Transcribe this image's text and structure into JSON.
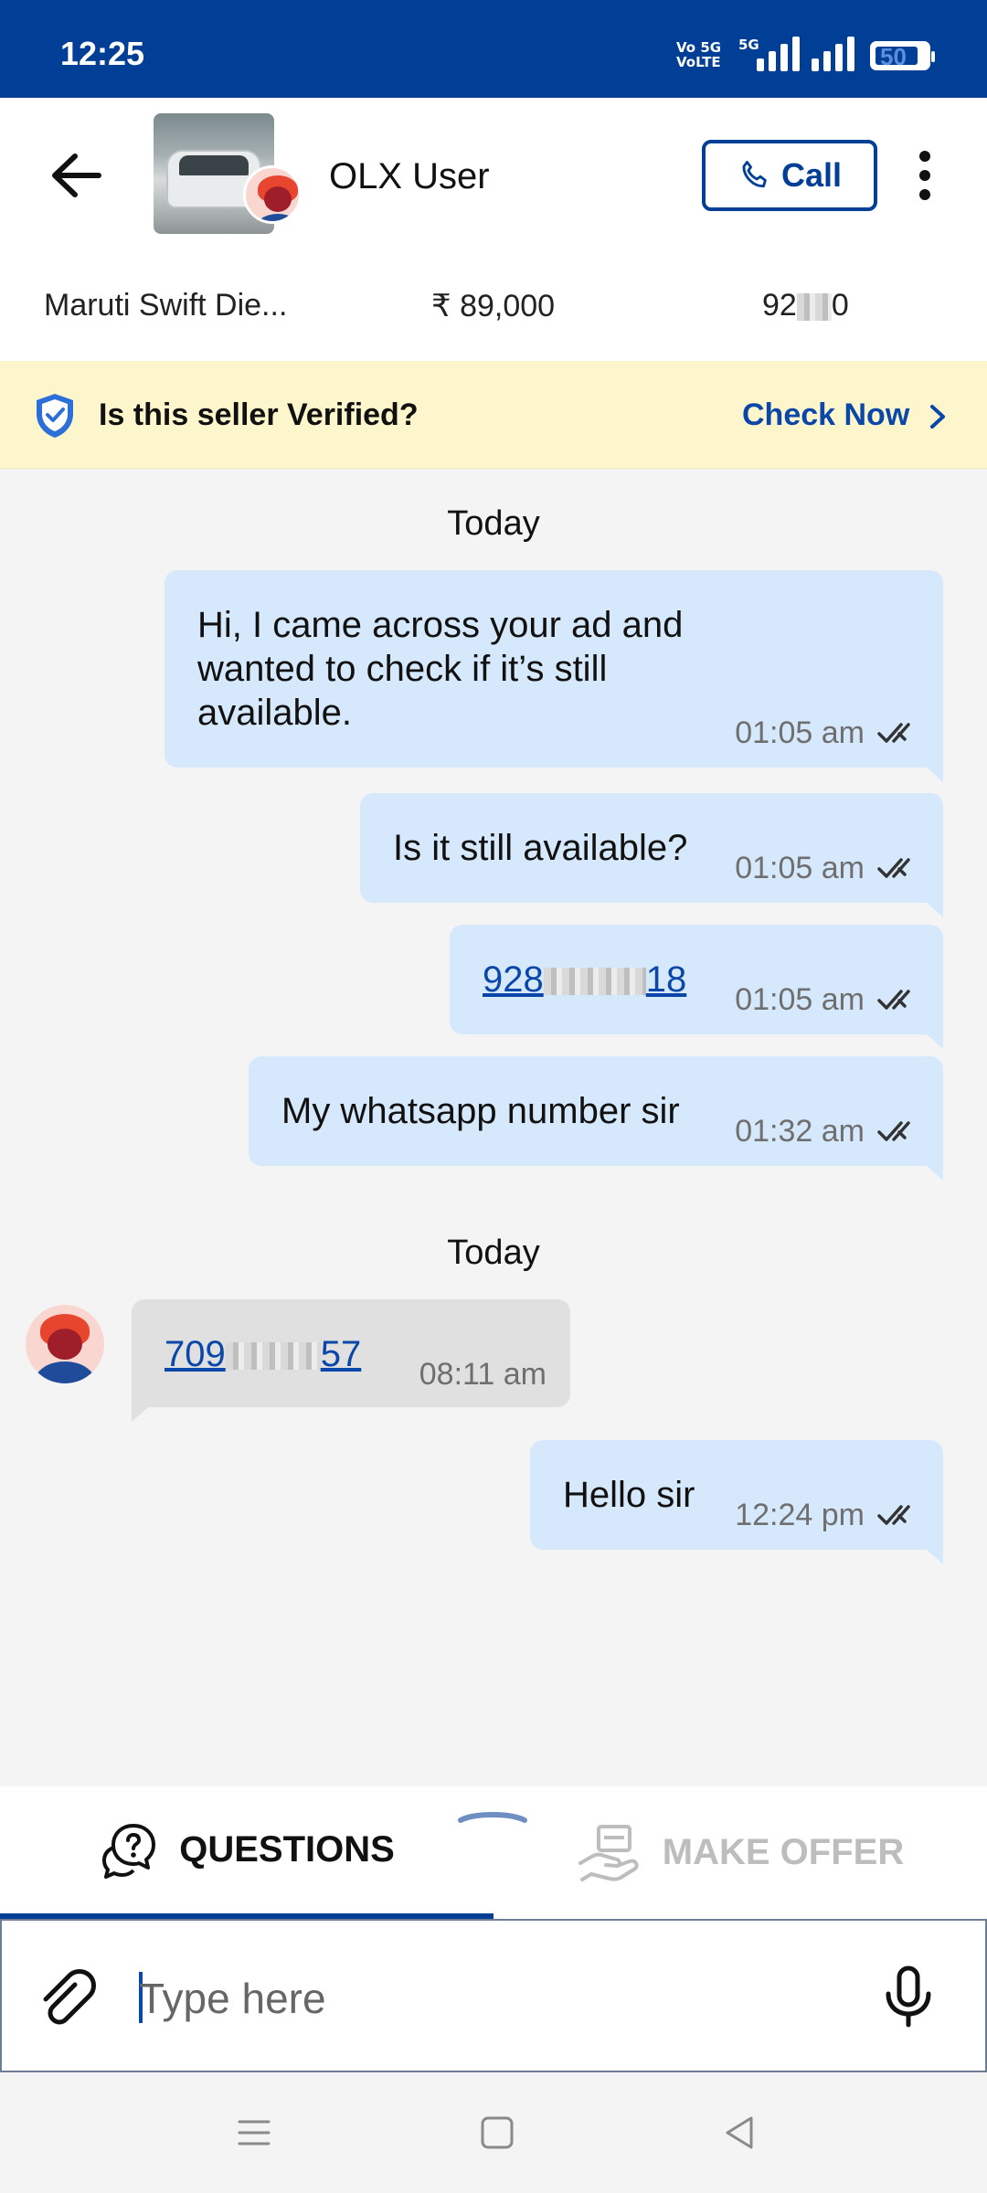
{
  "status_bar": {
    "time": "12:25",
    "network": "Vo 5G\nVoLTE",
    "network2": "5G",
    "battery": "50"
  },
  "header": {
    "contact_name": "OLX User",
    "call_label": "Call"
  },
  "ad": {
    "title": "Maruti Swift Die...",
    "price": "₹ 89,000",
    "km_prefix": "92",
    "km_suffix": "0"
  },
  "verify_banner": {
    "question": "Is this seller Verified?",
    "action": "Check Now"
  },
  "chat": {
    "date_1": "Today",
    "msg_1": {
      "text": "Hi, I came across your ad and wanted to check if it’s still available.",
      "time": "01:05 am"
    },
    "msg_2": {
      "text": "Is it still available?",
      "time": "01:05 am"
    },
    "msg_3": {
      "text_prefix": "928",
      "text_suffix": "18",
      "time": "01:05 am"
    },
    "msg_4": {
      "text": "My whatsapp number sir",
      "time": "01:32 am"
    },
    "date_2": "Today",
    "msg_5": {
      "text_prefix": "709",
      "text_suffix": "57",
      "time": "08:11 am"
    },
    "msg_6": {
      "text": "Hello sir",
      "time": "12:24 pm"
    }
  },
  "tabs": {
    "questions": "QUESTIONS",
    "make_offer": "MAKE OFFER"
  },
  "composer": {
    "placeholder": "Type here"
  },
  "colors": {
    "brand": "#003f95",
    "bubble_out": "#d6e8fb",
    "bubble_in": "#e0e0e0",
    "banner": "#fdf6cc",
    "link": "#0a47a9"
  },
  "icons": [
    "back-arrow-icon",
    "phone-icon",
    "more-vert-icon",
    "shield-check-icon",
    "chevron-right-icon",
    "double-tick-icon",
    "questions-icon",
    "make-offer-icon",
    "attach-icon",
    "mic-icon",
    "menu-icon",
    "home-icon",
    "back-nav-icon"
  ]
}
